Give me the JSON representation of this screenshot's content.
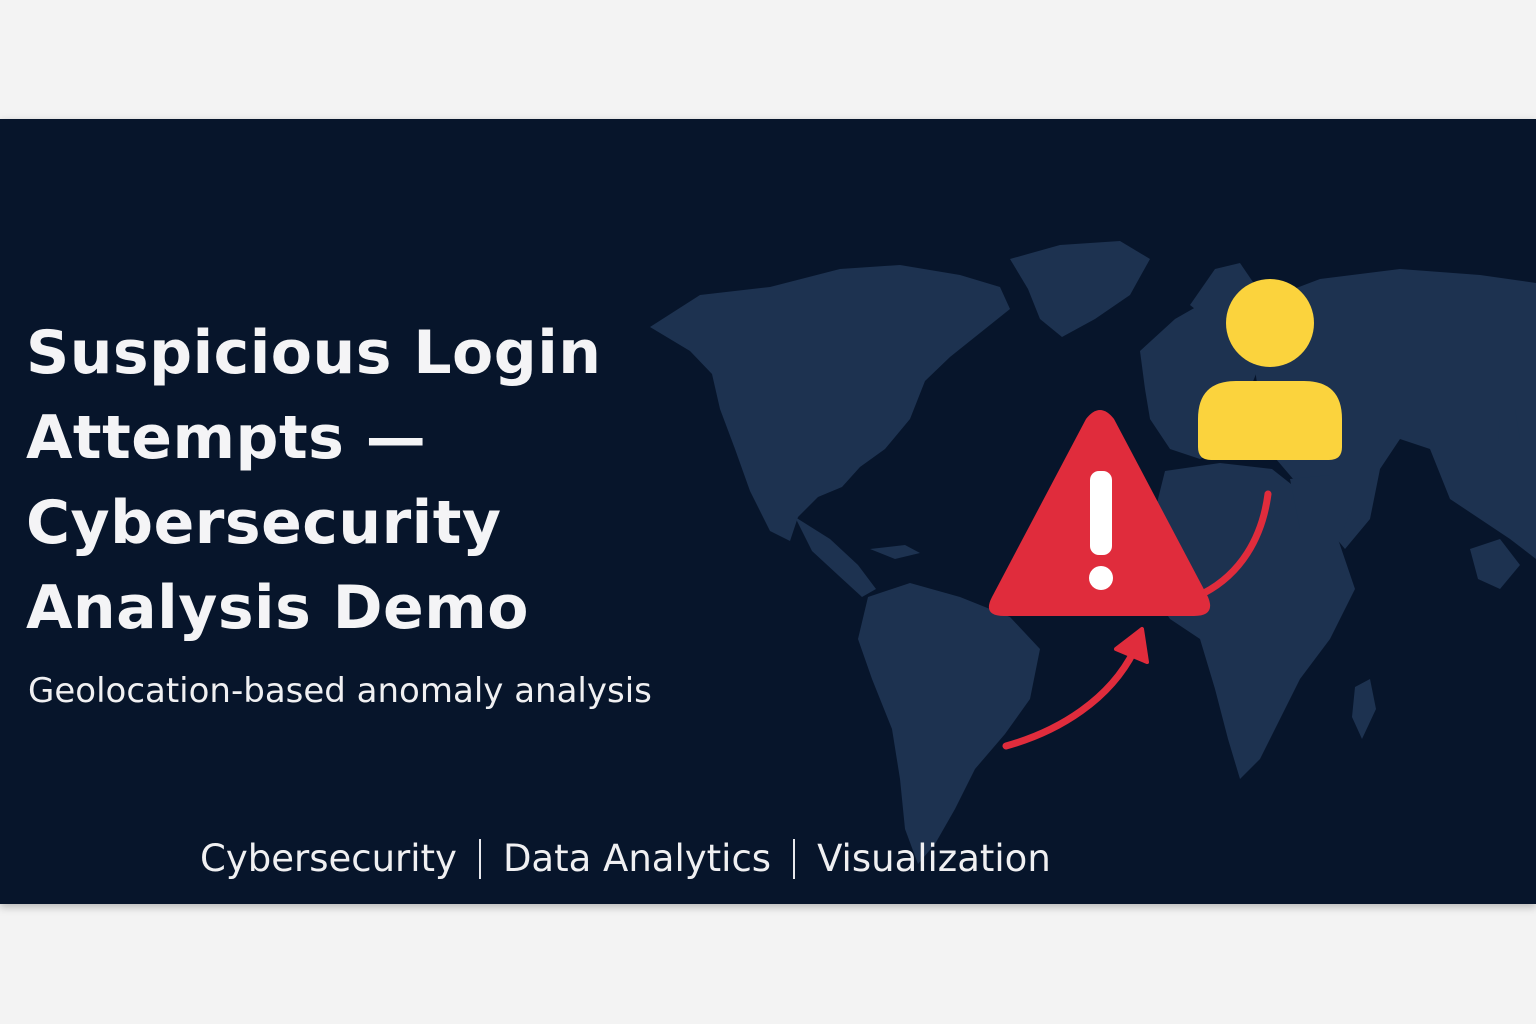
{
  "banner": {
    "title_lines": [
      "Suspicious Login",
      "Attempts —",
      "Cybersecurity",
      "Analysis Demo"
    ],
    "subtitle": "Geolocation-based anomaly analysis",
    "tags": [
      "Cybersecurity",
      "Data Analytics",
      "Visualization"
    ]
  },
  "icons": {
    "warning": "warning-triangle-icon",
    "user": "user-icon",
    "map": "world-map"
  },
  "colors": {
    "background": "#07152b",
    "page": "#f3f3f3",
    "map_land": "#1d3250",
    "warning_red": "#e02c3c",
    "user_yellow": "#fbd33d",
    "text": "#f4f4f6"
  }
}
